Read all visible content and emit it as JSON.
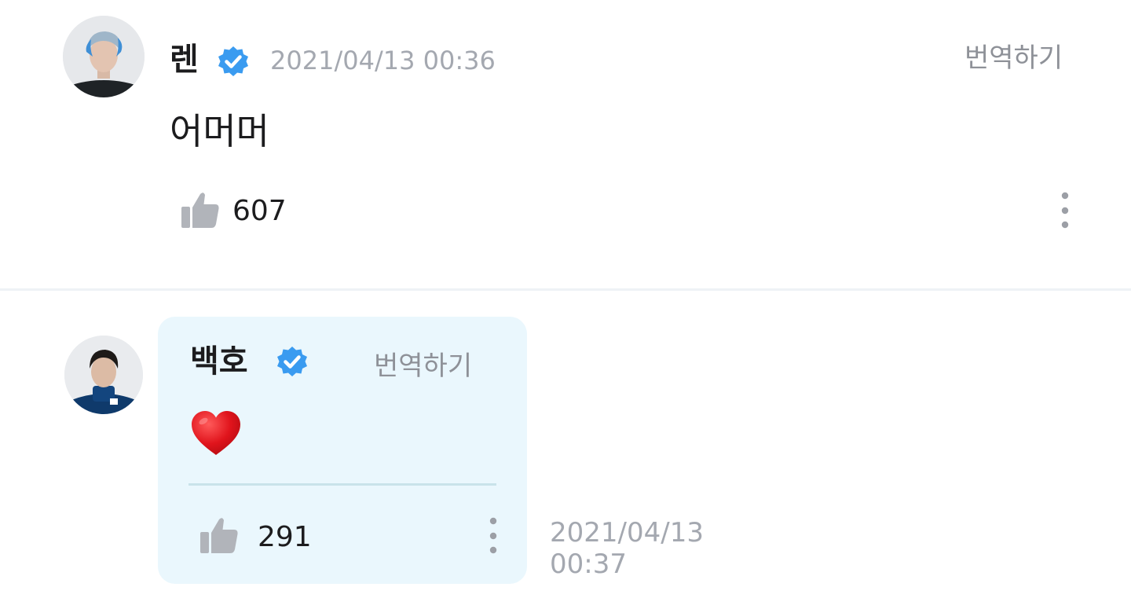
{
  "post": {
    "author": "렌",
    "timestamp": "2021/04/13 00:36",
    "translate_label": "번역하기",
    "message": "어머머",
    "like_count": "607",
    "icons": {
      "verified": "verified-badge-icon",
      "like": "thumbs-up-icon",
      "more": "more-vertical-icon"
    }
  },
  "reply": {
    "author": "백호",
    "translate_label": "번역하기",
    "message": "❤️",
    "like_count": "291",
    "timestamp_date": "2021/04/13",
    "timestamp_time": "00:37",
    "icons": {
      "verified": "verified-badge-icon",
      "like": "thumbs-up-icon",
      "more": "more-vertical-icon"
    }
  },
  "colors": {
    "verified_blue": "#3a9bf0",
    "reply_bubble_bg": "#eaf7fd",
    "muted_text": "#a4a8b0",
    "icon_gray": "#b1b4ba"
  }
}
